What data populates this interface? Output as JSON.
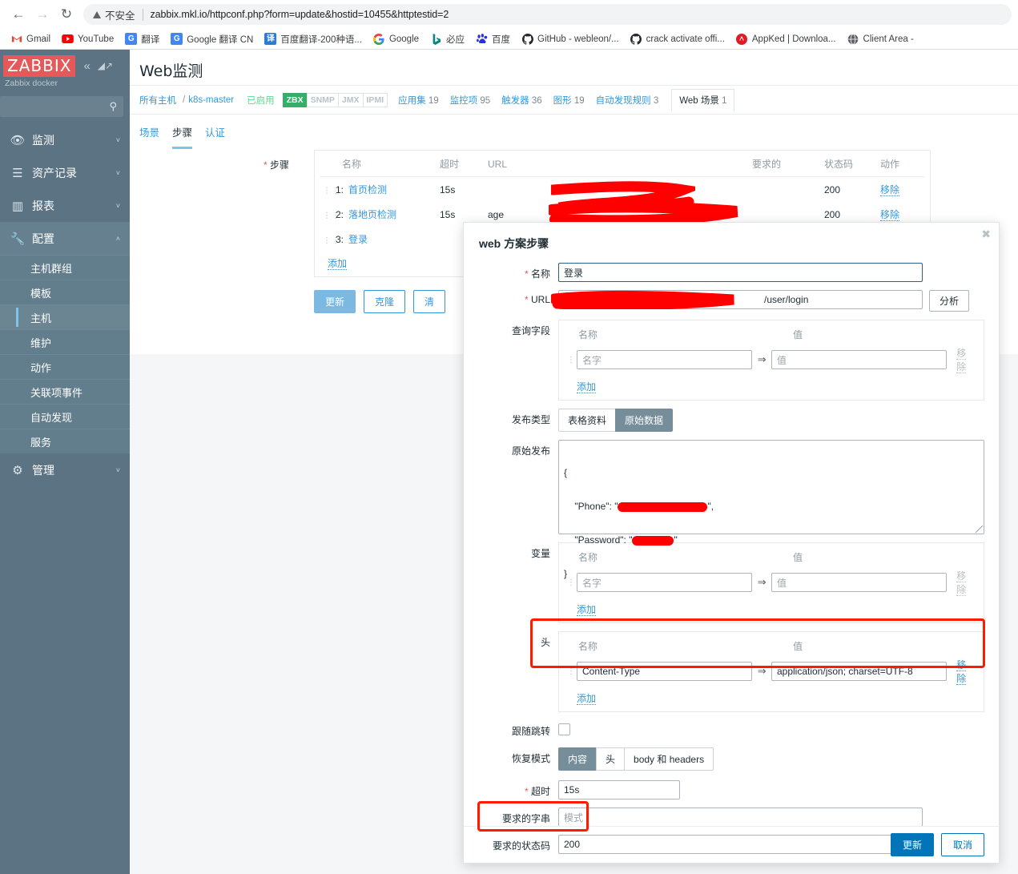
{
  "browser": {
    "back_icon": "back-arrow-icon",
    "forward_icon": "forward-arrow-icon",
    "reload_icon": "reload-icon",
    "security_label": "不安全",
    "url": "zabbix.mkl.io/httpconf.php?form=update&hostid=10455&httptestid=2",
    "bookmarks": [
      {
        "label": "Gmail",
        "icon": "gmail-icon",
        "icon_char": "M",
        "color": "#ea4335",
        "bg": "#ffffff"
      },
      {
        "label": "YouTube",
        "icon": "youtube-icon",
        "icon_char": "▶",
        "color": "#ffffff",
        "bg": "#ff0000"
      },
      {
        "label": "翻译",
        "icon": "google-translate-icon",
        "icon_char": "G",
        "color": "#ffffff",
        "bg": "#4285f4"
      },
      {
        "label": "Google 翻译 CN",
        "icon": "google-translate-cn-icon",
        "icon_char": "G",
        "color": "#ffffff",
        "bg": "#4285f4"
      },
      {
        "label": "百度翻译-200种语...",
        "icon": "baidu-translate-icon",
        "icon_char": "译",
        "color": "#ffffff",
        "bg": "#2b7cd3"
      },
      {
        "label": "Google",
        "icon": "google-icon",
        "icon_char": "G",
        "color": "#4285f4",
        "bg": "#ffffff"
      },
      {
        "label": "必应",
        "icon": "bing-icon",
        "icon_char": "b",
        "color": "#0d8484",
        "bg": "#ffffff"
      },
      {
        "label": "百度",
        "icon": "baidu-icon",
        "icon_char": "熊",
        "color": "#2932e1",
        "bg": "#ffffff"
      },
      {
        "label": "GitHub - webleon/...",
        "icon": "github-icon",
        "icon_char": "",
        "color": "#24292f",
        "bg": "#ffffff"
      },
      {
        "label": "crack activate offi...",
        "icon": "github-icon",
        "icon_char": "",
        "color": "#24292f",
        "bg": "#ffffff"
      },
      {
        "label": "AppKed | Downloa...",
        "icon": "appked-icon",
        "icon_char": "A",
        "color": "#ffffff",
        "bg": "#e01b24"
      },
      {
        "label": "Client Area - ",
        "icon": "globe-icon",
        "icon_char": "🌐",
        "color": "#5f6368",
        "bg": "#ffffff"
      }
    ]
  },
  "sidebar": {
    "logo": "ZABBIX",
    "server_name": "Zabbix docker",
    "collapse_icon": "double-chevron-left-icon",
    "expand_icon": "collapse-panel-icon",
    "search_placeholder": "",
    "search_icon": "search-icon",
    "items": [
      {
        "label": "监测",
        "icon": "eye-icon",
        "icon_char": "👁",
        "chevron": "˅",
        "active": false
      },
      {
        "label": "资产记录",
        "icon": "list-icon",
        "icon_char": "☰",
        "chevron": "˅",
        "active": false
      },
      {
        "label": "报表",
        "icon": "chart-bar-icon",
        "icon_char": "▥",
        "chevron": "˅",
        "active": false
      },
      {
        "label": "配置",
        "icon": "wrench-icon",
        "icon_char": "🔧",
        "chevron": "˄",
        "active": true
      }
    ],
    "sub_items": [
      {
        "label": "主机群组",
        "selected": false
      },
      {
        "label": "模板",
        "selected": false
      },
      {
        "label": "主机",
        "selected": true
      },
      {
        "label": "维护",
        "selected": false
      },
      {
        "label": "动作",
        "selected": false
      },
      {
        "label": "关联项事件",
        "selected": false
      },
      {
        "label": "自动发现",
        "selected": false
      },
      {
        "label": "服务",
        "selected": false
      }
    ],
    "admin": {
      "label": "管理",
      "icon": "gear-icon",
      "icon_char": "⚙",
      "chevron": "˅"
    }
  },
  "page": {
    "title": "Web监测",
    "breadcrumb": {
      "all_hosts": "所有主机",
      "separator": "/",
      "host": "k8s-master",
      "status": "已启用"
    },
    "protocols": [
      {
        "label": "ZBX",
        "on": true
      },
      {
        "label": "SNMP",
        "on": false
      },
      {
        "label": "JMX",
        "on": false
      },
      {
        "label": "IPMI",
        "on": false
      }
    ],
    "host_links": [
      {
        "label": "应用集",
        "count": "19"
      },
      {
        "label": "监控项",
        "count": "95"
      },
      {
        "label": "触发器",
        "count": "36"
      },
      {
        "label": "图形",
        "count": "19"
      },
      {
        "label": "自动发现规则",
        "count": "3"
      }
    ],
    "current_tab": {
      "label": "Web 场景",
      "count": "1"
    },
    "subtabs": [
      {
        "label": "场景",
        "active": false
      },
      {
        "label": "步骤",
        "active": true
      },
      {
        "label": "认证",
        "active": false
      }
    ]
  },
  "steps_form": {
    "label": "步骤",
    "columns": [
      "名称",
      "超时",
      "URL",
      "要求的",
      "状态码",
      "动作"
    ],
    "rows": [
      {
        "index": "1:",
        "name": "首页检测",
        "timeout": "15s",
        "url": "",
        "required": "",
        "status": "200",
        "action": "移除"
      },
      {
        "index": "2:",
        "name": "落地页检测",
        "timeout": "15s",
        "url": "age",
        "required": "",
        "status": "200",
        "action": "移除"
      },
      {
        "index": "3:",
        "name": "登录",
        "timeout": "",
        "url": "",
        "required": "",
        "status": "",
        "action": ""
      }
    ],
    "add_label": "添加",
    "buttons": [
      {
        "label": "更新",
        "primary": true
      },
      {
        "label": "克隆",
        "primary": false
      },
      {
        "label": "清",
        "primary": false
      }
    ]
  },
  "modal": {
    "title": "web 方案步骤",
    "close_icon": "close-icon",
    "name": {
      "label": "名称",
      "value": "登录",
      "required": true
    },
    "url": {
      "label": "URL",
      "value": "/user/login",
      "required": true,
      "parse_button": "分析"
    },
    "query_fields": {
      "label": "查询字段",
      "col_name": "名称",
      "col_value": "值",
      "name_placeholder": "名字",
      "value_placeholder": "值",
      "arrow": "⇒",
      "remove": "移除",
      "add": "添加"
    },
    "post_type": {
      "label": "发布类型",
      "options": [
        {
          "label": "表格资料",
          "on": false
        },
        {
          "label": "原始数据",
          "on": true
        }
      ]
    },
    "raw_post": {
      "label": "原始发布",
      "line1": "{",
      "line2_key": "    \"Phone\": \"",
      "line2_tail": "\",",
      "line3_key": "    \"Password\": \"",
      "line3_tail": "\"",
      "line4": "}"
    },
    "variables": {
      "label": "变量",
      "col_name": "名称",
      "col_value": "值",
      "name_placeholder": "名字",
      "value_placeholder": "值",
      "arrow": "⇒",
      "remove": "移除",
      "add": "添加"
    },
    "headers": {
      "label": "头",
      "col_name": "名称",
      "col_value": "值",
      "name_value": "Content-Type",
      "value_value": "application/json; charset=UTF-8",
      "arrow": "⇒",
      "remove": "移除",
      "add": "添加"
    },
    "follow_redirects": {
      "label": "跟随跳转",
      "checked": false
    },
    "retrieve_mode": {
      "label": "恢复模式",
      "options": [
        {
          "label": "内容",
          "on": true
        },
        {
          "label": "头",
          "on": false
        },
        {
          "label": "body 和 headers",
          "on": false
        }
      ]
    },
    "timeout": {
      "label": "超时",
      "value": "15s",
      "required": true
    },
    "required_string": {
      "label": "要求的字串",
      "value": "",
      "placeholder": "模式"
    },
    "required_status": {
      "label": "要求的状态码",
      "value": "200"
    },
    "footer": {
      "update": "更新",
      "cancel": "取消"
    }
  },
  "annotations": {
    "highlight_color": "#ff1a00",
    "redaction_color": "#ff0000",
    "boxes": [
      "headers-row-highlight",
      "required-status-highlight"
    ]
  }
}
